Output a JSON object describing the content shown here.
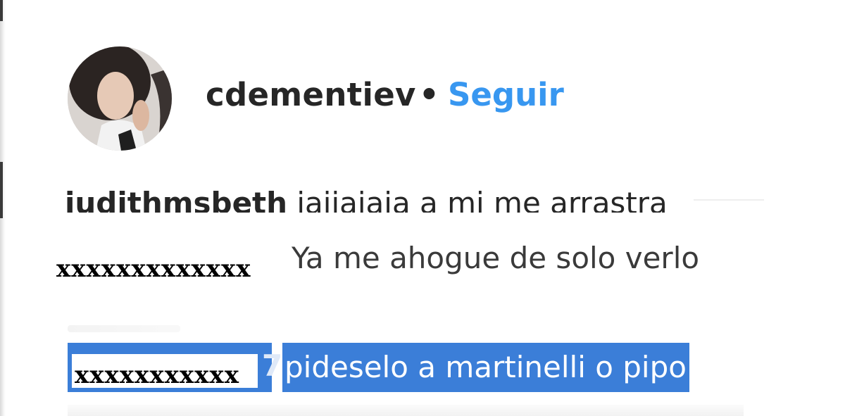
{
  "post": {
    "username": "cdementiev",
    "separator": "•",
    "follow_label": "Seguir"
  },
  "comments": [
    {
      "username": "judithmsbeth",
      "text": "jajjajaja a mi me arrastra"
    },
    {
      "username": "xxxxxxxxxxxxx",
      "text": "Ya me ahogue de solo verlo"
    },
    {
      "username": "xxxxxxxxxxx",
      "username_suffix": "7",
      "text": "pideselo a martinelli o pipo"
    }
  ],
  "colors": {
    "follow_blue": "#3897f0",
    "selection_blue": "#3b7ed8",
    "text_dark": "#262626"
  },
  "icons": {
    "avatar": "profile-photo"
  }
}
